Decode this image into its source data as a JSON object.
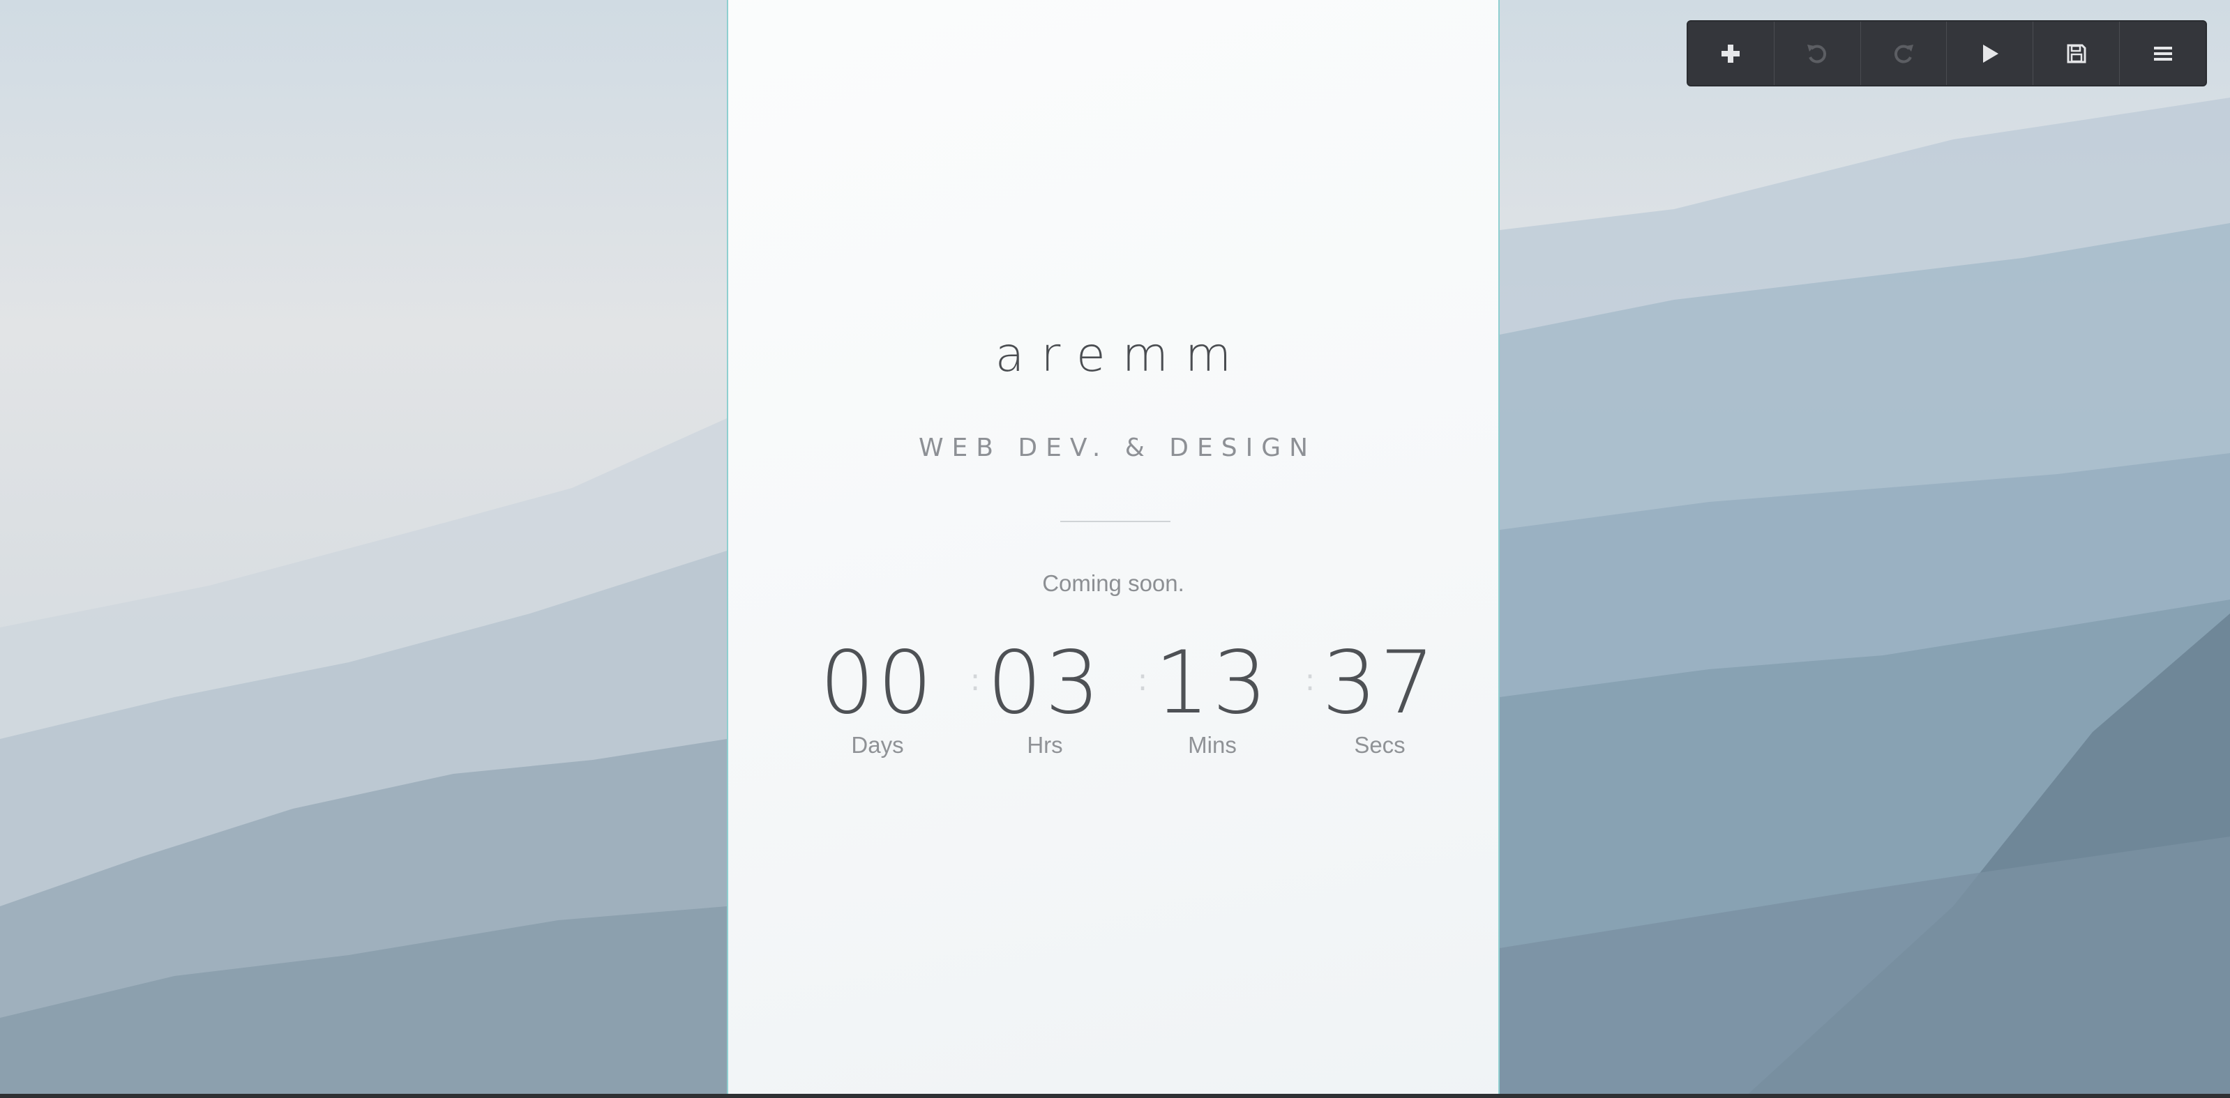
{
  "toolbar": {
    "buttons": [
      {
        "name": "add",
        "icon": "plus-icon",
        "enabled": true
      },
      {
        "name": "undo",
        "icon": "undo-icon",
        "enabled": false
      },
      {
        "name": "redo",
        "icon": "redo-icon",
        "enabled": false
      },
      {
        "name": "preview",
        "icon": "play-icon",
        "enabled": true
      },
      {
        "name": "save",
        "icon": "floppy-disk-icon",
        "enabled": true
      },
      {
        "name": "menu",
        "icon": "hamburger-menu-icon",
        "enabled": true
      }
    ]
  },
  "page": {
    "brand": "aremm",
    "tagline": "WEB DEV. & DESIGN",
    "coming_soon": "Coming soon.",
    "countdown": {
      "days": {
        "value": "00",
        "label": "Days"
      },
      "hours": {
        "value": "03",
        "label": "Hrs"
      },
      "minutes": {
        "value": "13",
        "label": "Mins"
      },
      "seconds": {
        "value": "37",
        "label": "Secs"
      },
      "separator": ":"
    }
  },
  "colors": {
    "panel_border": "#8fcfd0",
    "toolbar_bg": "#34363b",
    "text_dark": "#4a4d51",
    "text_muted": "#8c8f93"
  }
}
